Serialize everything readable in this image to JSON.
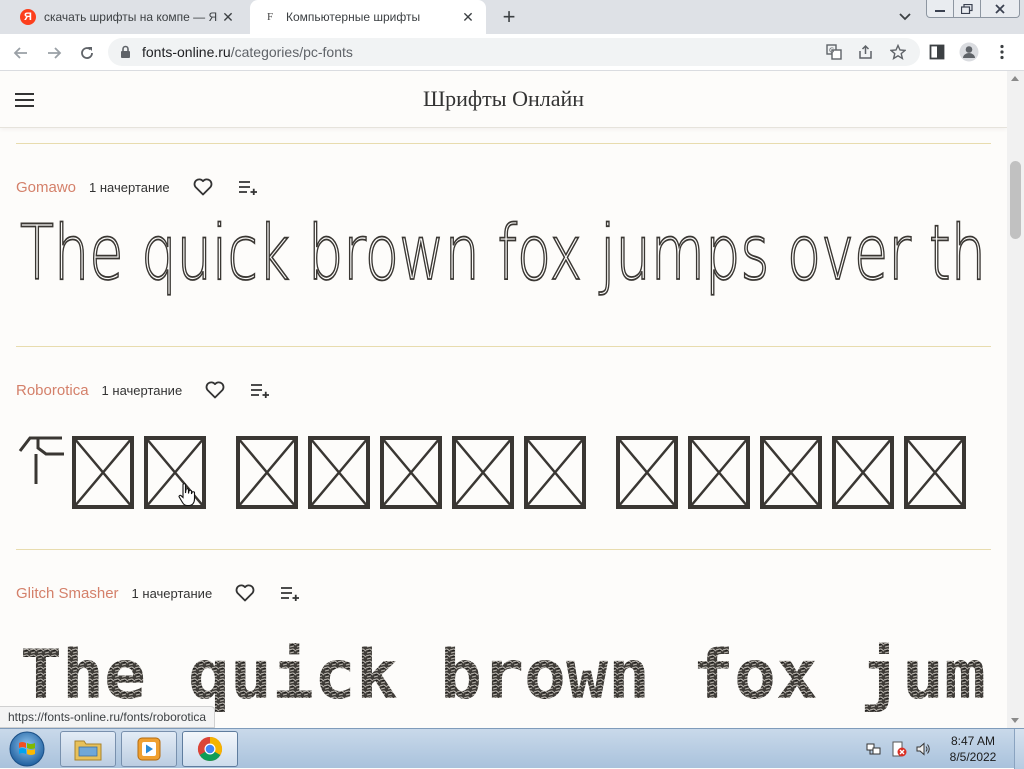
{
  "browser": {
    "tabs": [
      {
        "title": "скачать шрифты на компе — Ян",
        "favicon": "yandex-icon",
        "favicon_text": "Я",
        "active": false
      },
      {
        "title": "Компьютерные шрифты",
        "favicon": "site-favicon",
        "favicon_text": "F",
        "active": true
      }
    ],
    "url_domain": "fonts-online.ru",
    "url_path": "/categories/pc-fonts"
  },
  "site": {
    "title": "Шрифты Онлайн"
  },
  "fonts": [
    {
      "name": "Gomawo",
      "styles": "1 начертание",
      "preview": "The quick brown fox jumps over th"
    },
    {
      "name": "Roborotica",
      "styles": "1 начертание",
      "preview": "The quick brown fox jumps over the lazy dog",
      "preview_glyph": "T"
    },
    {
      "name": "Glitch Smasher",
      "styles": "1 начертание",
      "preview": "The quick brown fox jum"
    }
  ],
  "status_url": "https://fonts-online.ru/fonts/roborotica",
  "taskbar": {
    "time": "8:47 AM",
    "date": "8/5/2022"
  },
  "colors": {
    "accent": "#d4806a",
    "divider": "#e8dcae",
    "page_bg": "#fdfcfa",
    "text": "#333333"
  }
}
